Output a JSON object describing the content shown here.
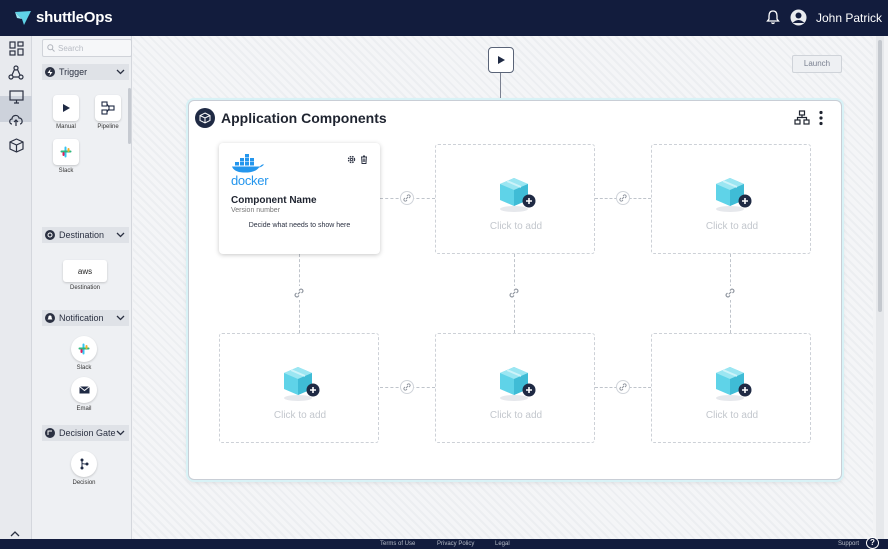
{
  "app": {
    "brand": "shuttleOps",
    "user_name": "John Patrick"
  },
  "colors": {
    "topbar": "#121c3d",
    "accent": "#5fd3e8",
    "cube_dark": "#1f2a44"
  },
  "sidebar": {
    "search_placeholder": "Search",
    "sections": [
      {
        "title": "Trigger",
        "items": [
          "Manual",
          "Pipeline",
          "Slack"
        ]
      },
      {
        "title": "Destination",
        "items": [
          "Destination"
        ],
        "badge": "aws"
      },
      {
        "title": "Notification",
        "items": [
          "Slack",
          "Email"
        ]
      },
      {
        "title": "Decision Gate",
        "items": [
          "Decision"
        ]
      }
    ]
  },
  "rail_icons": [
    "dashboard-icon",
    "apps-icon",
    "monitor-icon",
    "cloud-upload-icon",
    "box-icon"
  ],
  "canvas": {
    "launch_label": "Launch",
    "app_title": "Application Components",
    "component": {
      "logo_text": "docker",
      "name": "Component Name",
      "version": "Version number",
      "description": "Decide what needs to show here"
    },
    "empty_slot_label": "Click to add"
  },
  "footer": {
    "links": [
      "Terms of Use",
      "Privacy Policy",
      "Legal"
    ],
    "support": "Support",
    "help": "?"
  }
}
